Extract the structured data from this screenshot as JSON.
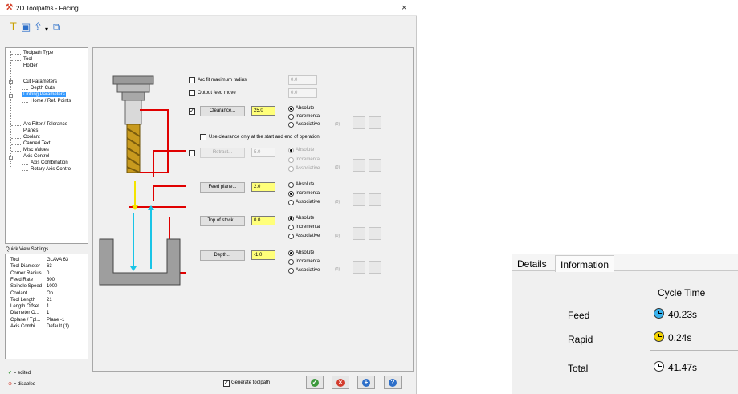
{
  "window": {
    "title": "2D Toolpaths - Facing",
    "close_glyph": "×"
  },
  "toolbar": {
    "icons": [
      "tool-icon",
      "save-icon",
      "upload-icon",
      "dropdown-arrow-icon",
      "export-icon"
    ]
  },
  "tree": {
    "items": [
      {
        "label": "Toolpath Type"
      },
      {
        "label": "Tool"
      },
      {
        "label": "Holder"
      },
      {
        "label": "Cut Parameters"
      },
      {
        "label": "Depth Cuts"
      },
      {
        "label": "Linking Parameters"
      },
      {
        "label": "Home / Ref. Points"
      },
      {
        "label": "Arc Filter / Tolerance"
      },
      {
        "label": "Planes"
      },
      {
        "label": "Coolant"
      },
      {
        "label": "Canned Text"
      },
      {
        "label": "Misc Values"
      },
      {
        "label": "Axis Control"
      },
      {
        "label": "Axis Combination"
      },
      {
        "label": "Rotary Axis Control"
      }
    ]
  },
  "quick_view": {
    "title": "Quick View Settings",
    "rows": [
      {
        "key": "Tool",
        "value": "GLAVA 63"
      },
      {
        "key": "Tool Diameter",
        "value": "63"
      },
      {
        "key": "Corner Radius",
        "value": "0"
      },
      {
        "key": "Feed Rate",
        "value": "800"
      },
      {
        "key": "Spindle Speed",
        "value": "1000"
      },
      {
        "key": "Coolant",
        "value": "On"
      },
      {
        "key": "Tool Length",
        "value": "21"
      },
      {
        "key": "Length Offset",
        "value": "1"
      },
      {
        "key": "Diameter O...",
        "value": "1"
      },
      {
        "key": "Cplane / Tpl...",
        "value": "Plane -1"
      },
      {
        "key": "Axis Combi...",
        "value": "Default (1)"
      }
    ]
  },
  "legend": {
    "edited": "= edited",
    "disabled": "= disabled"
  },
  "linking": {
    "arc_fit": {
      "label": "Arc fit maximum radius",
      "value": "0.0"
    },
    "output_feed": {
      "label": "Output feed move",
      "value": "0.0"
    },
    "clearance": {
      "button": "Clearance...",
      "value": "25.0",
      "radios": [
        "Absolute",
        "Incremental",
        "Associative"
      ],
      "selected": "Absolute"
    },
    "use_clearance": "Use clearance only at the start and end of operation",
    "retract": {
      "button": "Retract...",
      "value": "5.0",
      "radios": [
        "Absolute",
        "Incremental",
        "Associative"
      ],
      "selected": "Absolute"
    },
    "feed_plane": {
      "button": "Feed plane...",
      "value": "2.0",
      "radios": [
        "Absolute",
        "Incremental",
        "Associative"
      ],
      "selected": "Incremental"
    },
    "top_of_stock": {
      "button": "Top of stock...",
      "value": "0.0",
      "radios": [
        "Absolute",
        "Incremental",
        "Associative"
      ],
      "selected": "Absolute"
    },
    "depth": {
      "button": "Depth...",
      "value": "-1.0",
      "radios": [
        "Absolute",
        "Incremental",
        "Associative"
      ],
      "selected": "Absolute"
    },
    "assoc_count": "(0)"
  },
  "footer": {
    "generate_label": "Generate toolpath",
    "buttons": [
      "ok-button",
      "cancel-button",
      "add-button",
      "help-button"
    ],
    "colors": {
      "ok": "#3c9a3c",
      "cancel": "#d33b2c",
      "add": "#2d6fc9",
      "help": "#2d6fc9"
    }
  },
  "info": {
    "tabs": [
      "Details",
      "Information"
    ],
    "active_tab": "Information",
    "header": "Cycle Time",
    "rows": [
      {
        "label": "Feed",
        "value": "40.23s",
        "icon": "clock-blue-icon"
      },
      {
        "label": "Rapid",
        "value": "0.24s",
        "icon": "clock-yellow-icon"
      },
      {
        "label": "Total",
        "value": "41.47s",
        "icon": "clock-white-icon"
      }
    ]
  },
  "colors": {
    "highlight": "#3399ff",
    "yellow_field": "#ffff7a",
    "red_line": "#e00000",
    "cyan_arrow": "#19c4e6",
    "yellow_arrow": "#f4e400"
  }
}
